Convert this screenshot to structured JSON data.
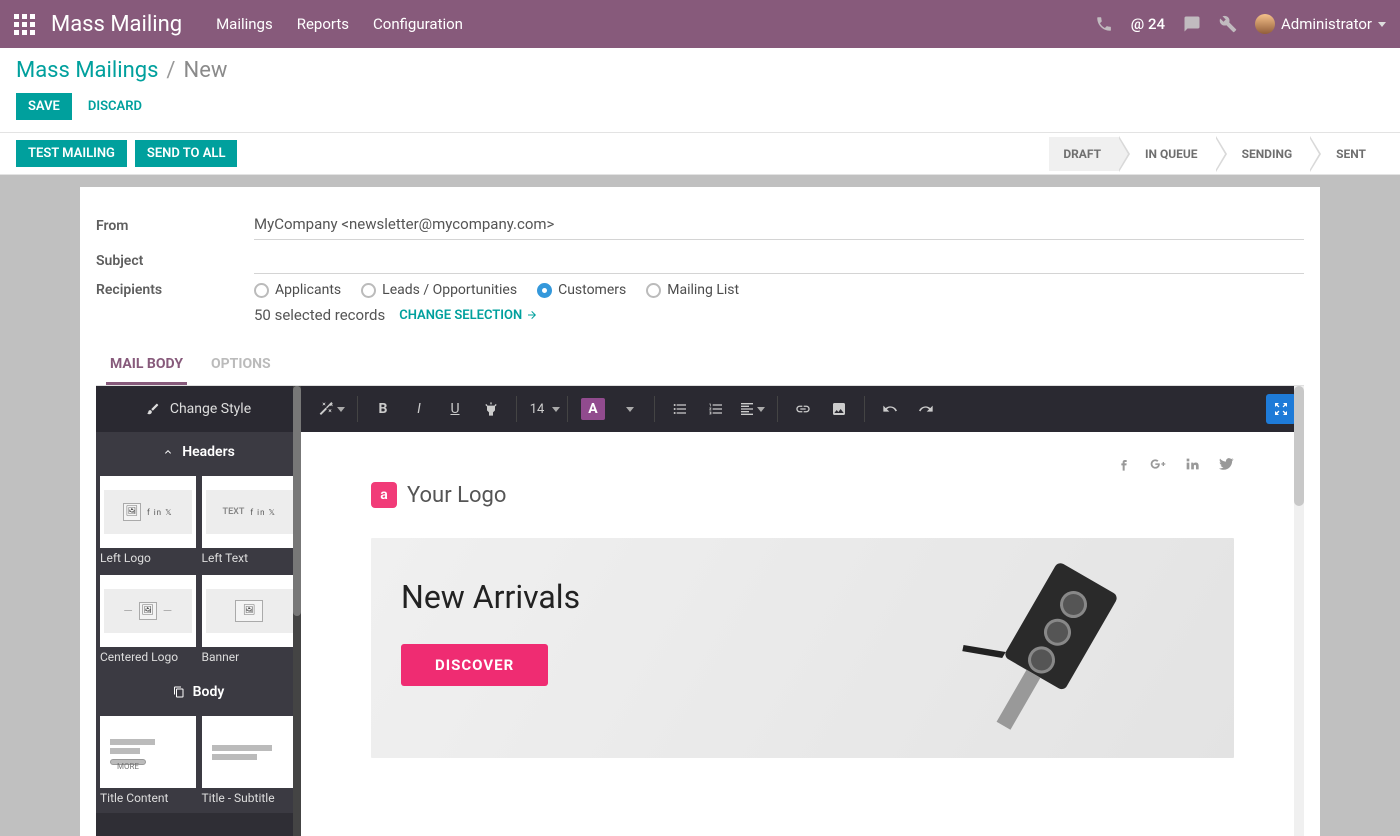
{
  "topbar": {
    "app_name": "Mass Mailing",
    "nav": [
      "Mailings",
      "Reports",
      "Configuration"
    ],
    "at_count": "@ 24",
    "user": "Administrator"
  },
  "breadcrumb": {
    "root": "Mass Mailings",
    "sep": "/",
    "current": "New"
  },
  "actions": {
    "save": "SAVE",
    "discard": "DISCARD",
    "test": "TEST MAILING",
    "send_all": "SEND TO ALL"
  },
  "status_steps": [
    "DRAFT",
    "IN QUEUE",
    "SENDING",
    "SENT"
  ],
  "status_active_index": 0,
  "form": {
    "labels": {
      "from": "From",
      "subject": "Subject",
      "recipients": "Recipients"
    },
    "from_value": "MyCompany <newsletter@mycompany.com>",
    "subject_value": "",
    "recipient_options": [
      "Applicants",
      "Leads / Opportunities",
      "Customers",
      "Mailing List"
    ],
    "recipient_selected_index": 2,
    "selected_records_text": "50 selected records",
    "change_selection": "CHANGE SELECTION"
  },
  "tabs": {
    "items": [
      "MAIL BODY",
      "OPTIONS"
    ],
    "active_index": 0
  },
  "editor": {
    "change_style": "Change Style",
    "font_size": "14",
    "sections": {
      "headers": "Headers",
      "body": "Body"
    },
    "header_blocks": [
      "Left Logo",
      "Left Text",
      "Centered Logo",
      "Banner"
    ],
    "body_blocks": [
      "Title Content",
      "Title - Subtitle"
    ],
    "text_thumb": "TEXT",
    "more_pill": "MORE"
  },
  "mail_preview": {
    "logo_letter": "a",
    "logo_text": "Your Logo",
    "banner_title": "New Arrivals",
    "discover": "DISCOVER"
  }
}
